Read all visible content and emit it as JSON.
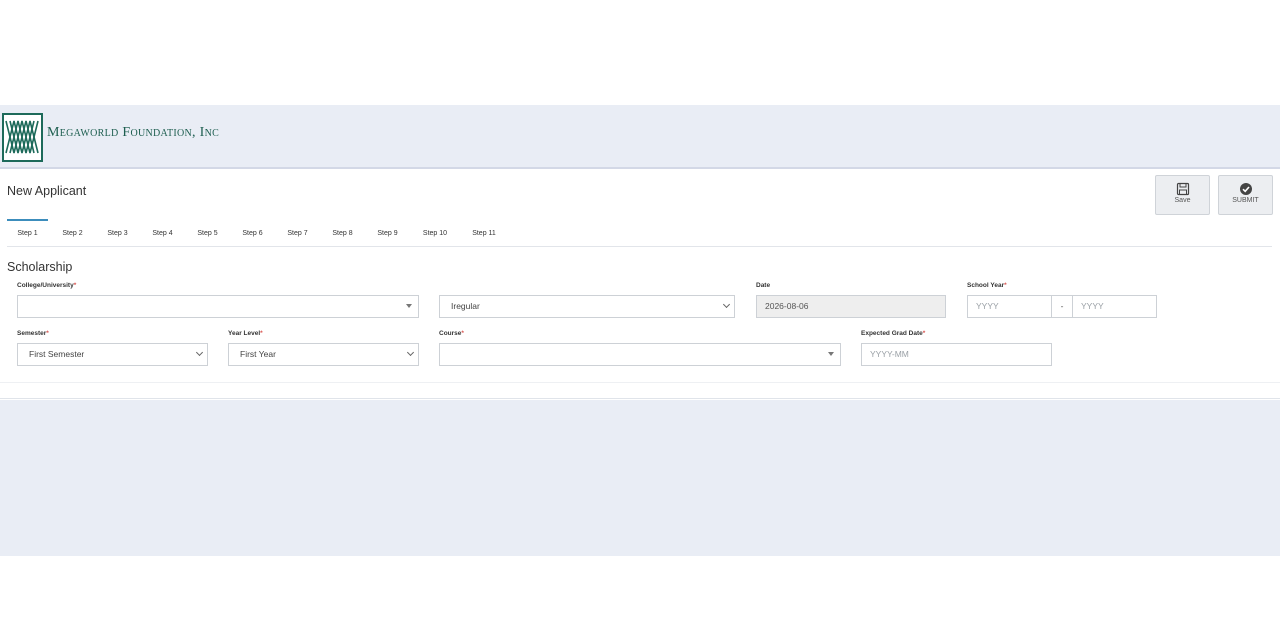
{
  "header": {
    "logo_text": "Megaworld Foundation, Inc",
    "logo_icon": "megaworld-logo-icon",
    "brand_color": "#1d6a5a"
  },
  "page": {
    "title": "New Applicant"
  },
  "actions": {
    "save_label": "Save",
    "save_icon": "floppy-disk-icon",
    "submit_label": "SUBMIT",
    "submit_icon": "check-circle-icon"
  },
  "tabs": [
    "Step 1",
    "Step 2",
    "Step 3",
    "Step 4",
    "Step 5",
    "Step 6",
    "Step 7",
    "Step 8",
    "Step 9",
    "Step 10",
    "Step 11"
  ],
  "active_tab": "Step 1",
  "section": {
    "title": "Scholarship"
  },
  "form": {
    "college_label": "College/University",
    "college_value": "",
    "type_value": "Iregular",
    "date_label": "Date",
    "date_value": "2026-08-06",
    "school_year_label": "School Year",
    "school_year_from_placeholder": "YYYY",
    "school_year_sep": "-",
    "school_year_to_placeholder": "YYYY",
    "semester_label": "Semester",
    "semester_value": "First Semester",
    "year_level_label": "Year Level",
    "year_level_value": "First Year",
    "course_label": "Course",
    "course_value": "",
    "grad_label": "Expected Grad Date",
    "grad_placeholder": "YYYY-MM",
    "required_mark": "*"
  }
}
